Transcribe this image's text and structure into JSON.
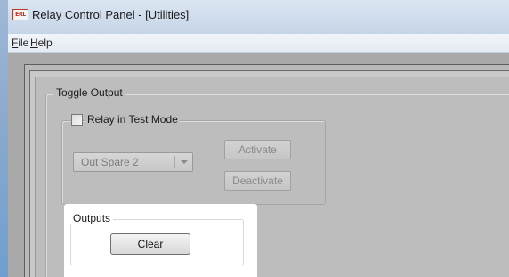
{
  "window": {
    "title": "Relay Control Panel - [Utilities]",
    "icon_text": "ERL"
  },
  "menu": {
    "file": {
      "mnemonic": "F",
      "rest": "ile"
    },
    "help": {
      "mnemonic": "H",
      "rest": "elp"
    }
  },
  "toggle_output": {
    "group_label": "Toggle Output",
    "relay_test_mode": {
      "label": "Relay in Test Mode",
      "checked": false
    },
    "output_select": {
      "value": "Out Spare 2",
      "enabled": false
    },
    "activate_label": "Activate",
    "deactivate_label": "Deactivate"
  },
  "outputs": {
    "group_label": "Outputs",
    "clear_label": "Clear"
  }
}
